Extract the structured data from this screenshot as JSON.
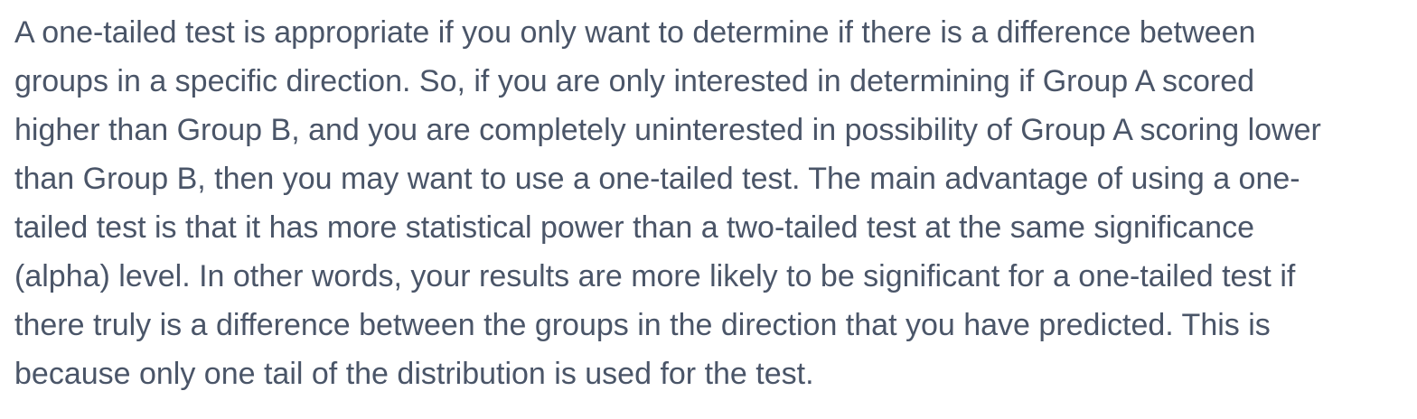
{
  "paragraph": {
    "lines": [
      "A one-tailed test is appropriate if you only want to determine if there is a difference between",
      "groups in a specific direction. So, if you are only interested in determining if Group A scored",
      "higher than Group B, and you are completely uninterested in possibility of Group A scoring lower",
      "than Group B, then you may want to use a one-tailed test. The main advantage of using a one-",
      "tailed test is that it has more statistical power than a two-tailed test at the same significance",
      "(alpha) level. In other words, your results are more likely to be significant for a one-tailed test if",
      "there truly is a difference between the groups in the direction that you have predicted. This is",
      "because only one tail of the distribution is used for the test."
    ]
  },
  "colors": {
    "text": "#4a5568",
    "background": "#ffffff"
  }
}
